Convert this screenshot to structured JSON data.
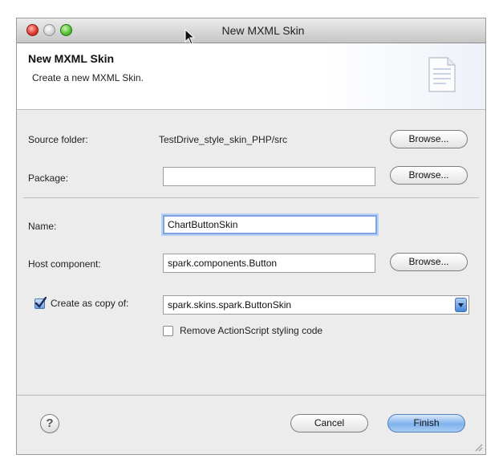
{
  "window": {
    "title": "New MXML Skin"
  },
  "banner": {
    "title": "New MXML Skin",
    "subtitle": "Create a new MXML Skin."
  },
  "form": {
    "source_folder": {
      "label": "Source folder:",
      "value": "TestDrive_style_skin_PHP/src",
      "browse": "Browse..."
    },
    "package": {
      "label": "Package:",
      "value": "",
      "browse": "Browse..."
    },
    "name": {
      "label": "Name:",
      "value": "ChartButtonSkin"
    },
    "host_component": {
      "label": "Host component:",
      "value": "spark.components.Button",
      "browse": "Browse..."
    },
    "create_copy": {
      "label": "Create as copy of:",
      "checked": true,
      "value": "spark.skins.spark.ButtonSkin"
    },
    "remove_styling": {
      "label": "Remove ActionScript styling code",
      "checked": false
    }
  },
  "footer": {
    "help": "?",
    "cancel": "Cancel",
    "finish": "Finish"
  },
  "colors": {
    "default_button": "#7fb2ec",
    "close_light": "#d9372b",
    "max_light": "#4fbf2f"
  }
}
